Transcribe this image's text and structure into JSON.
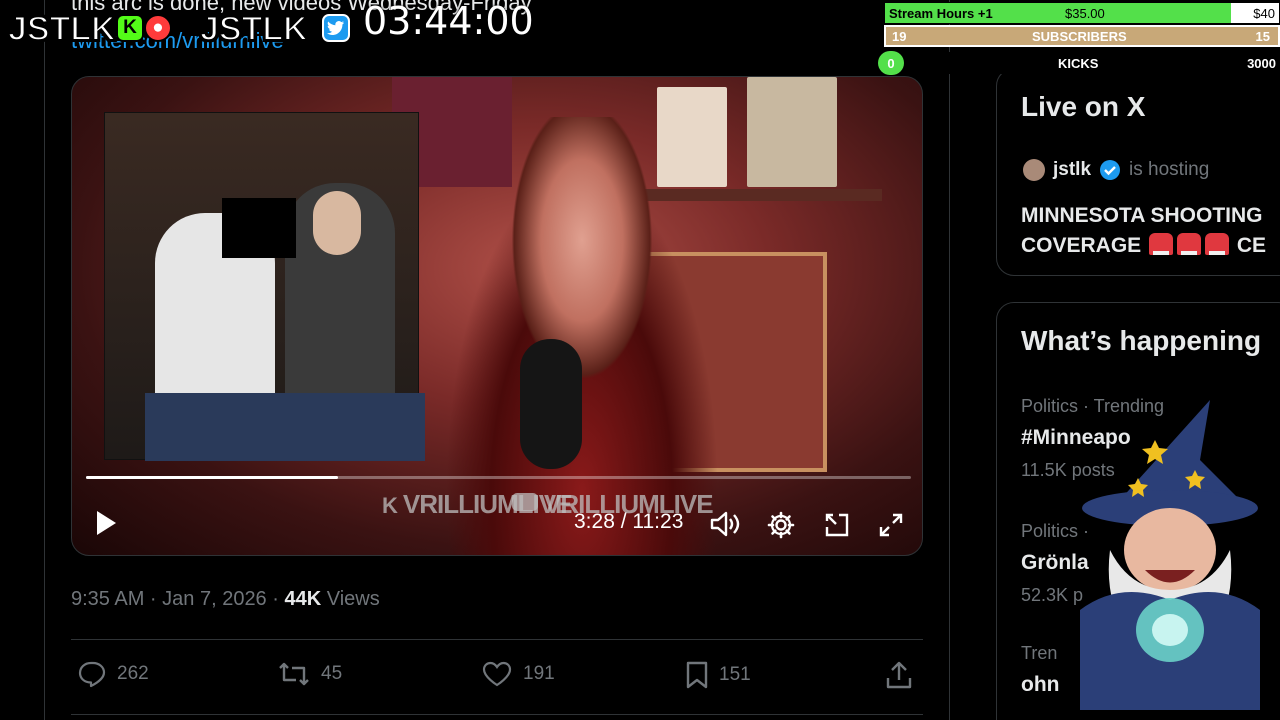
{
  "tweet": {
    "text_partial": "this arc is done, new videos Wednesday-Friday",
    "link_partial": "twitter.com/vrilliumlive",
    "timestamp": "9:35 AM · Jan 7, 2026 ·",
    "views_count": "44K",
    "views_label": "Views",
    "actions": {
      "replies": "262",
      "reposts": "45",
      "likes": "191",
      "bookmarks": "151"
    }
  },
  "video": {
    "current_time": "3:28",
    "duration": "11:23",
    "time_display": "3:28 / 11:23",
    "progress_fraction": 0.305,
    "watermark_kick": "VRILLIUMLIVE",
    "watermark_youtube": "VRILLIUMLIVE"
  },
  "sidebar": {
    "live_card": {
      "title": "Live on X",
      "host_name": "jstlk",
      "host_suffix": "is hosting",
      "line1": "MINNESOTA SHOOTING",
      "line2": "COVERAGE",
      "line2_suffix": "CE"
    },
    "happening": {
      "title": "What’s happening",
      "trends": [
        {
          "category": "Politics · Trending",
          "name": "#Minneapo",
          "count": "11.5K posts"
        },
        {
          "category": "Politics · ",
          "name": "Grönla",
          "count": "52.3K p"
        },
        {
          "category": "Tren",
          "name": "ohn",
          "count": ""
        }
      ]
    }
  },
  "overlay": {
    "brand_left": "JSTLK",
    "brand_right": "JSTLK_",
    "timer": "03:44:00",
    "goal_bar_1": {
      "label": "Stream Hours +1",
      "amount": "$35.00",
      "target": "$40"
    },
    "goal_bar_2": {
      "left": "19",
      "label": "SUBSCRIBERS",
      "right": "15"
    },
    "goal_bar_3": {
      "left": "0",
      "label": "KICKS",
      "right": "3000"
    }
  },
  "colors": {
    "accent": "#1d9bf0",
    "green": "#53fc18",
    "kick_green": "#53fc18",
    "verified": "#1d9bf0",
    "subs_bar": "#c8a878"
  }
}
